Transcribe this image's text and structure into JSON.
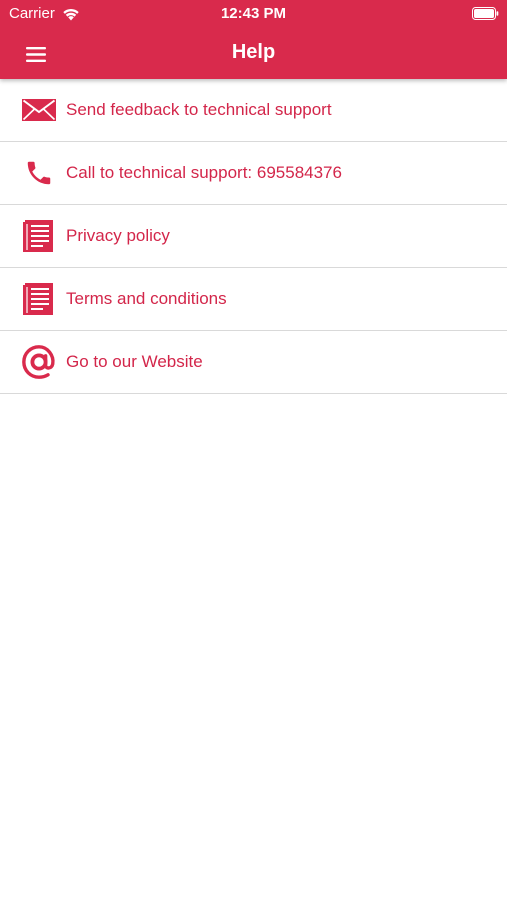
{
  "status_bar": {
    "carrier": "Carrier",
    "time": "12:43 PM"
  },
  "header": {
    "title": "Help",
    "menu_icon": "hamburger-menu-icon"
  },
  "colors": {
    "accent": "#d92a4c",
    "text": "#d3264a",
    "divider": "#d9d9d9"
  },
  "items": [
    {
      "label": "Send feedback to technical support",
      "icon": "envelope-icon"
    },
    {
      "label": "Call to technical support: 695584376",
      "icon": "phone-icon"
    },
    {
      "label": "Privacy policy",
      "icon": "document-icon"
    },
    {
      "label": "Terms and conditions",
      "icon": "document-icon"
    },
    {
      "label": "Go to our Website",
      "icon": "at-sign-icon"
    }
  ]
}
